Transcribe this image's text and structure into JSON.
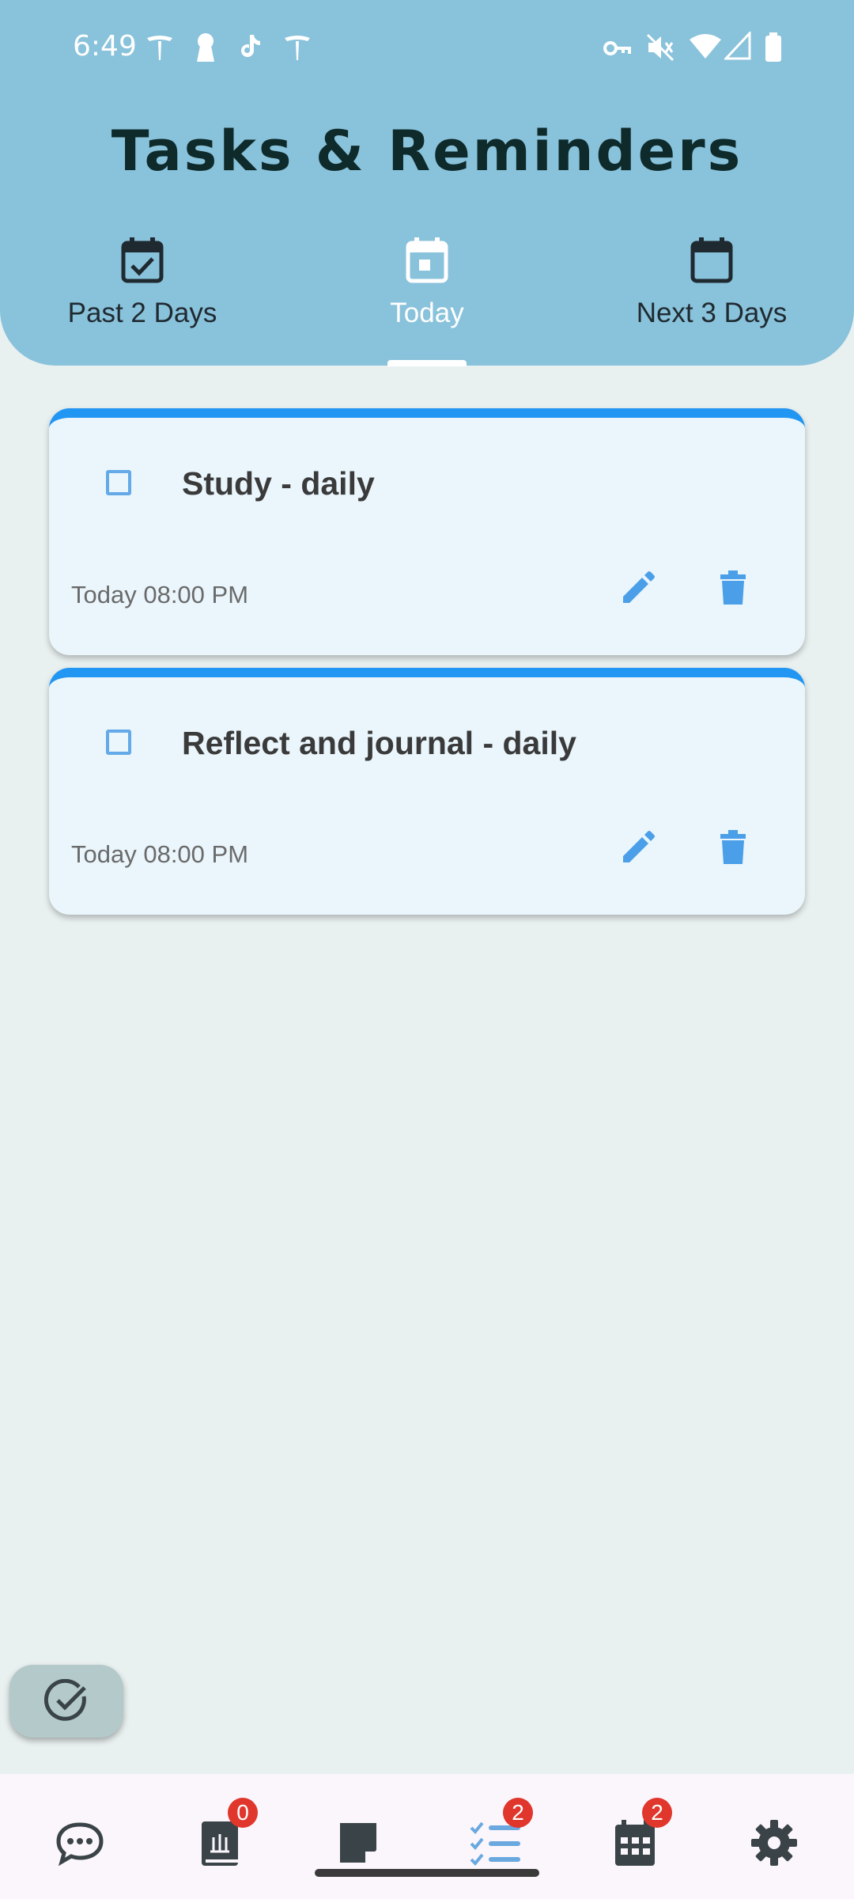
{
  "status_bar": {
    "time": "6:49"
  },
  "header": {
    "title": "Tasks & Reminders"
  },
  "tabs": [
    {
      "label": "Past 2 Days",
      "icon": "calendar-check-icon"
    },
    {
      "label": "Today",
      "icon": "calendar-today-icon"
    },
    {
      "label": "Next 3 Days",
      "icon": "calendar-icon"
    }
  ],
  "active_tab": "Today",
  "tasks": [
    {
      "title": "Study - daily",
      "date": "Today 08:00 PM",
      "checked": false
    },
    {
      "title": "Reflect and journal - daily",
      "date": "Today 08:00 PM",
      "checked": false
    }
  ],
  "bottom_nav": [
    {
      "icon": "chat-icon",
      "badge": ""
    },
    {
      "icon": "journal-icon",
      "badge": "0"
    },
    {
      "icon": "note-icon",
      "badge": ""
    },
    {
      "icon": "tasks-icon",
      "badge": "2"
    },
    {
      "icon": "calendar-icon",
      "badge": "2"
    },
    {
      "icon": "settings-icon",
      "badge": ""
    }
  ],
  "colors": {
    "header": "#89c2db",
    "accent": "#2196f3",
    "card": "#eaf6fc",
    "badge": "#e0362c"
  }
}
